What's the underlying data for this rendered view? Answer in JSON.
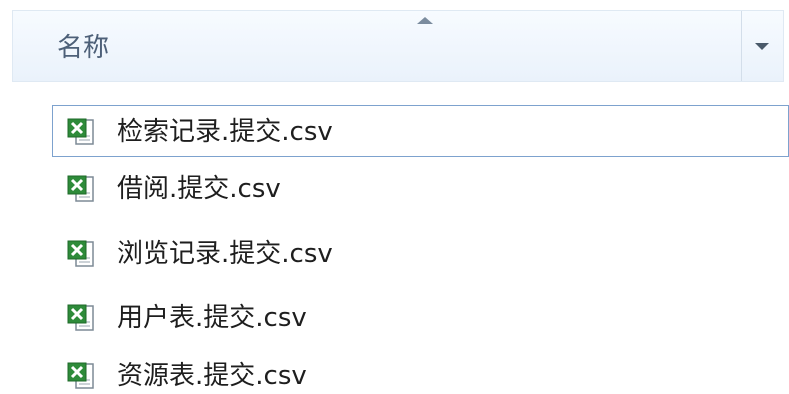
{
  "header": {
    "name_column": "名称"
  },
  "files": [
    {
      "name": "检索记录.提交.csv",
      "icon": "excel-csv-icon",
      "selected": true
    },
    {
      "name": "借阅.提交.csv",
      "icon": "excel-csv-icon",
      "selected": false
    },
    {
      "name": "浏览记录.提交.csv",
      "icon": "excel-csv-icon",
      "selected": false
    },
    {
      "name": "用户表.提交.csv",
      "icon": "excel-csv-icon",
      "selected": false
    },
    {
      "name": "资源表.提交.csv",
      "icon": "excel-csv-icon",
      "selected": false
    }
  ],
  "colors": {
    "header_text": "#4d6078",
    "selection_border": "#7da2ce",
    "icon_green": "#2e8b3a"
  }
}
